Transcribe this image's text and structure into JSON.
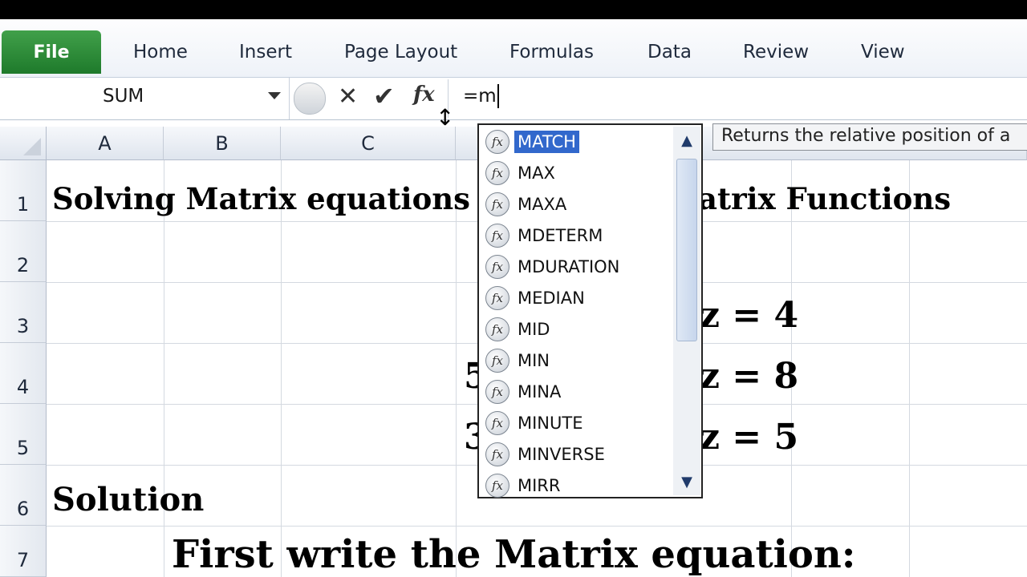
{
  "ribbon": {
    "file_label": "File",
    "tabs": [
      "Home",
      "Insert",
      "Page Layout",
      "Formulas",
      "Data",
      "Review",
      "View"
    ]
  },
  "formula_bar": {
    "name_box": "SUM",
    "cancel_glyph": "✕",
    "enter_glyph": "✔",
    "fx_glyph": "fx",
    "formula": "=m"
  },
  "columns": [
    "A",
    "B",
    "C"
  ],
  "rows": [
    "1",
    "2",
    "3",
    "4",
    "5",
    "6",
    "7"
  ],
  "cells": {
    "r1_left": "Solving Matrix equations u",
    "r1_right": "atrix Functions",
    "r3_right": "z = 4",
    "r4_left": "5",
    "r4_right": "z = 8",
    "r5_left": "3",
    "r5_right": "z = 5",
    "r6": "Solution",
    "r7": "First write the Matrix equation:"
  },
  "autocomplete": {
    "items": [
      "MATCH",
      "MAX",
      "MAXA",
      "MDETERM",
      "MDURATION",
      "MEDIAN",
      "MID",
      "MIN",
      "MINA",
      "MINUTE",
      "MINVERSE",
      "MIRR"
    ],
    "selected_index": 0,
    "icon_glyph": "fx"
  },
  "tooltip": "Returns the relative position of a",
  "icons": {
    "name_box_dropdown": "chevron-down-icon",
    "cancel": "close-icon",
    "enter": "check-icon",
    "insert_function": "function-icon",
    "resize": "resize-vertical-icon",
    "scroll_up": "chevron-up-icon",
    "scroll_down": "chevron-down-icon"
  },
  "colors": {
    "file_tab": "#2e8b3a",
    "selection": "#3268cc"
  }
}
